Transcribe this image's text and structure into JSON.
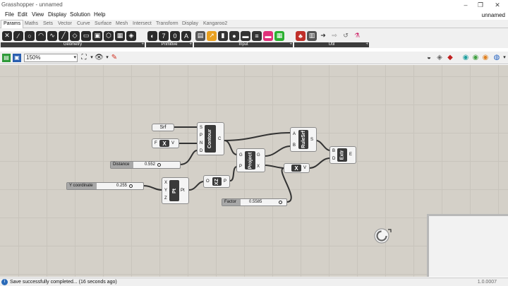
{
  "window": {
    "title": "Grasshopper - unnamed",
    "document": "unnamed"
  },
  "menu": [
    "File",
    "Edit",
    "View",
    "Display",
    "Solution",
    "Help"
  ],
  "tabs": [
    "Params",
    "Maths",
    "Sets",
    "Vector",
    "Curve",
    "Surface",
    "Mesh",
    "Intersect",
    "Transform",
    "Display",
    "Kangaroo2"
  ],
  "ribbon_groups": {
    "geometry": "Geometry",
    "primitive": "Primitive",
    "input": "Input",
    "util": "Util"
  },
  "toolbar": {
    "zoom": "150%"
  },
  "canvas": {
    "srf_param": "Srf",
    "contour": {
      "name": "Contour",
      "inputs": [
        "S",
        "P",
        "N",
        "D"
      ],
      "output": "C"
    },
    "x_param": {
      "left": "F",
      "label": "X",
      "right": "V"
    },
    "distance": {
      "label": "Distance",
      "value": "0.552"
    },
    "y_coord": {
      "label": "Y coordinate",
      "value": "0.255"
    },
    "pt": {
      "name": "Pt",
      "inputs": [
        "X",
        "Y",
        "Z"
      ],
      "output": "Pt"
    },
    "xz": {
      "name": "XZ",
      "input": "O",
      "output": "P"
    },
    "project": {
      "name": "Project",
      "inputs": [
        "G",
        "P"
      ],
      "outputs": [
        "G",
        "X"
      ]
    },
    "rulesrf": {
      "name": "RuleSrf",
      "inputs": [
        "A",
        "B"
      ],
      "output": "S"
    },
    "extr": {
      "name": "Extr",
      "inputs": [
        "B",
        "D"
      ],
      "output": "E"
    },
    "mult": {
      "label": "X",
      "right": "V"
    },
    "factor": {
      "label": "Factor",
      "value": "0.5585"
    }
  },
  "status": {
    "message": "Save successfully completed... (16 seconds ago)",
    "version": "1.0.0007"
  }
}
